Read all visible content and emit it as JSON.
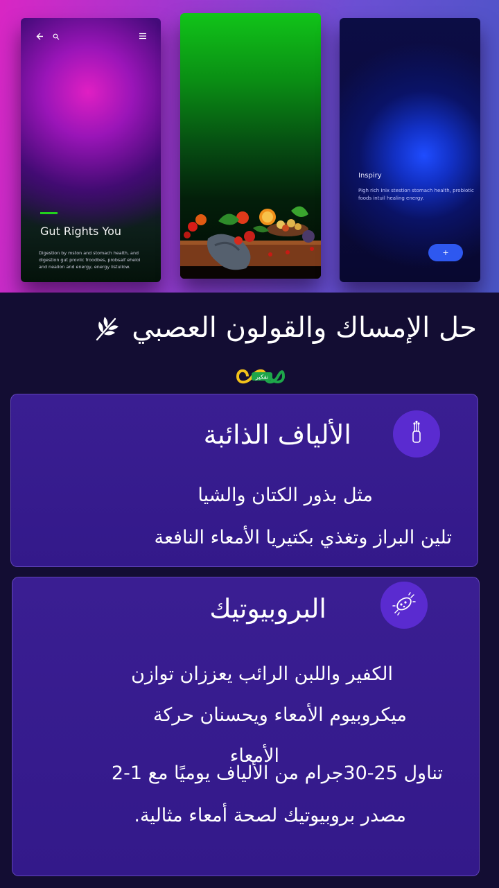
{
  "hero": {
    "screen1": {
      "title": "Gut Rights You",
      "body": "Digestion by mston and stomach health, and digestion gut provlic froodbes, probsalf ehelol and nealion and energy, energy listullow."
    },
    "screen3": {
      "title": "Inspiry",
      "body": "Pigh rich Inix stestion stomach health, probiotic foods intuil healing energy.",
      "fab_label": "+"
    }
  },
  "heading": {
    "title": "حل الإمساك والقولون العصبي",
    "icon": "leaf-icon"
  },
  "logo": {
    "text": "تفكير",
    "icon": "infinity-logo"
  },
  "cards": [
    {
      "icon": "fiber-icon",
      "title": "الألياف الذائبة",
      "lines": [
        "مثل بذور الكتان والشيا",
        "تلين البراز وتغذي بكتيريا الأمعاء النافعة"
      ]
    },
    {
      "icon": "bacteria-icon",
      "title": "البروبيوتيك",
      "lines": [
        "الكفير واللبن الرائب يعززان توازن",
        "ميكروبيوم الأمعاء ويحسنان حركة",
        "الأمعاء",
        "تناول 25-30جرام من الألياف يوميًا مع 1-2",
        "مصدر بروبيوتيك لصحة أمعاء مثالية."
      ]
    }
  ],
  "colors": {
    "background": "#130d33",
    "card": "#3a1e92",
    "badge": "#5a2bd0",
    "accent_green": "#22d01d",
    "fab_blue": "#2e58f0"
  }
}
